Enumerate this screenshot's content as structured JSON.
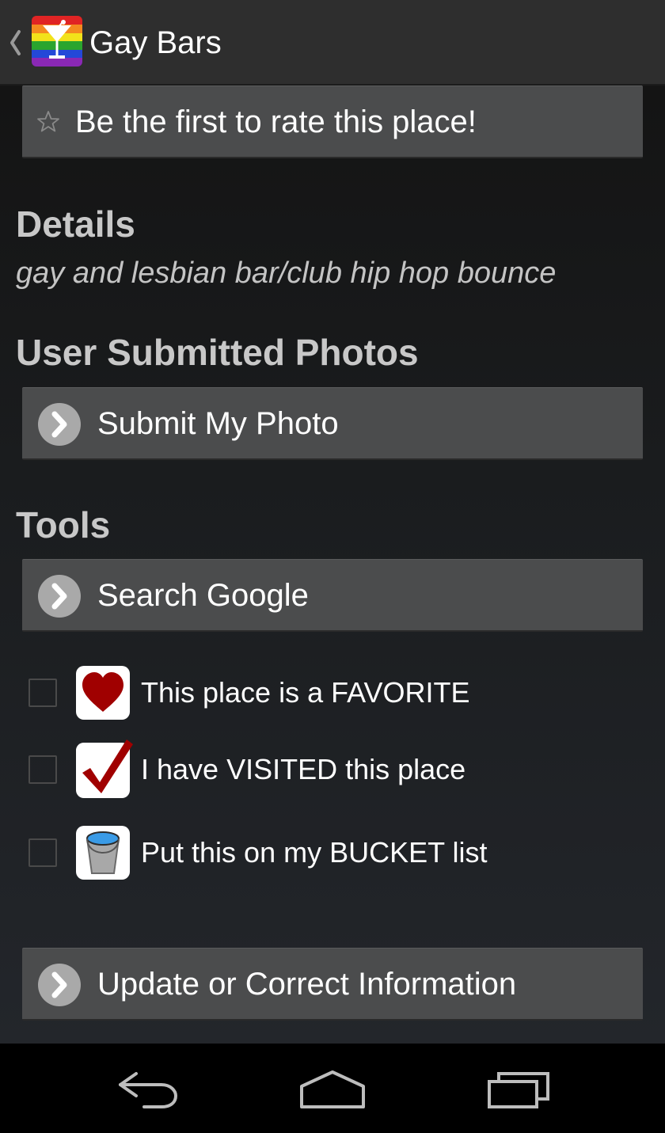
{
  "action_bar": {
    "title": "Gay Bars",
    "up_icon": "chevron-left-icon",
    "app_icon": "rainbow-martini-icon"
  },
  "rating": {
    "label": "Be the first to rate this place!",
    "icon": "star-outline-icon"
  },
  "details": {
    "heading": "Details",
    "text": "gay and lesbian bar/club hip hop bounce"
  },
  "photos": {
    "heading": "User Submitted Photos",
    "submit_label": "Submit My Photo"
  },
  "tools": {
    "heading": "Tools",
    "search_label": "Search Google"
  },
  "checklist": [
    {
      "label": "This place is a FAVORITE",
      "icon": "heart-icon",
      "checked": false
    },
    {
      "label": "I have VISITED this place",
      "icon": "checkmark-icon",
      "checked": false
    },
    {
      "label": "Put this on my BUCKET list",
      "icon": "bucket-icon",
      "checked": false
    }
  ],
  "update": {
    "label": "Update or Correct Information"
  },
  "nav": {
    "back_icon": "back-icon",
    "home_icon": "home-icon",
    "recents_icon": "recent-apps-icon"
  },
  "colors": {
    "action_bar": "#2e2e2e",
    "button": "#4b4c4d",
    "heading": "#c8c8c8",
    "heart": "#a00000",
    "check": "#a00000",
    "bucket_water": "#3a9be6"
  }
}
